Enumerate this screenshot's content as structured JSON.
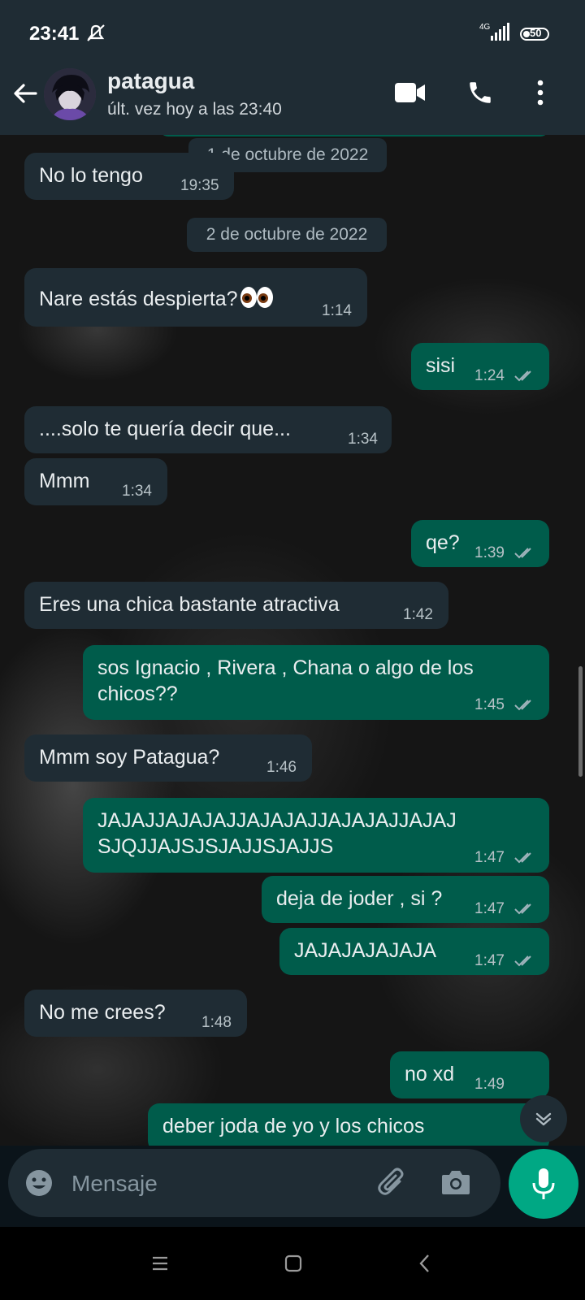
{
  "status_bar": {
    "time": "23:41",
    "network": "4G",
    "battery": "50"
  },
  "header": {
    "name": "patagua",
    "last_seen": "últ. vez hoy a las 23:40"
  },
  "dates": {
    "d1": "1 de octubre de 2022",
    "d2": "2 de octubre de 2022"
  },
  "messages": [
    {
      "dir": "in",
      "text": "No lo tengo",
      "time": "19:35"
    },
    {
      "dir": "in",
      "text": "Nare estás despierta?",
      "time": "1:14"
    },
    {
      "dir": "out",
      "text": "sisi",
      "time": "1:24",
      "status": "read"
    },
    {
      "dir": "in",
      "text": "....solo te quería decir que...",
      "time": "1:34"
    },
    {
      "dir": "in",
      "text": "Mmm",
      "time": "1:34"
    },
    {
      "dir": "out",
      "text": "qe?",
      "time": "1:39",
      "status": "read"
    },
    {
      "dir": "in",
      "text": "Eres una chica bastante atractiva",
      "time": "1:42"
    },
    {
      "dir": "out",
      "lines": [
        "sos Ignacio , Rivera , Chana o algo de los",
        "chicos??"
      ],
      "time": "1:45",
      "status": "read"
    },
    {
      "dir": "in",
      "text": "Mmm soy Patagua?",
      "time": "1:46"
    },
    {
      "dir": "out",
      "lines": [
        "JAJAJJAJAJAJJAJAJAJJAJAJAJJAJAJ",
        "SJQJJAJSJSJAJJSJAJJS"
      ],
      "time": "1:47",
      "status": "read"
    },
    {
      "dir": "out",
      "text": "deja de joder , si ?",
      "time": "1:47",
      "status": "read"
    },
    {
      "dir": "out",
      "text": "JAJAJAJAJAJA",
      "time": "1:47",
      "status": "read"
    },
    {
      "dir": "in",
      "text": "No me crees?",
      "time": "1:48"
    },
    {
      "dir": "out",
      "text": "no xd",
      "time": "1:49",
      "status": "read"
    },
    {
      "dir": "out",
      "text": "deber joda de yo y los chicos",
      "time": "",
      "status": "partial"
    }
  ],
  "composer": {
    "placeholder": "Mensaje"
  },
  "colors": {
    "incoming": "#1f2c34",
    "outgoing": "#005c4b",
    "accent": "#00a884",
    "header": "#1f2c34"
  },
  "icons": [
    "back-arrow-icon",
    "video-call-icon",
    "phone-icon",
    "more-vert-icon",
    "emoji-icon",
    "attach-icon",
    "camera-icon",
    "mic-icon",
    "chevron-down-icon",
    "read-ticks-icon",
    "eyes-emoji"
  ]
}
